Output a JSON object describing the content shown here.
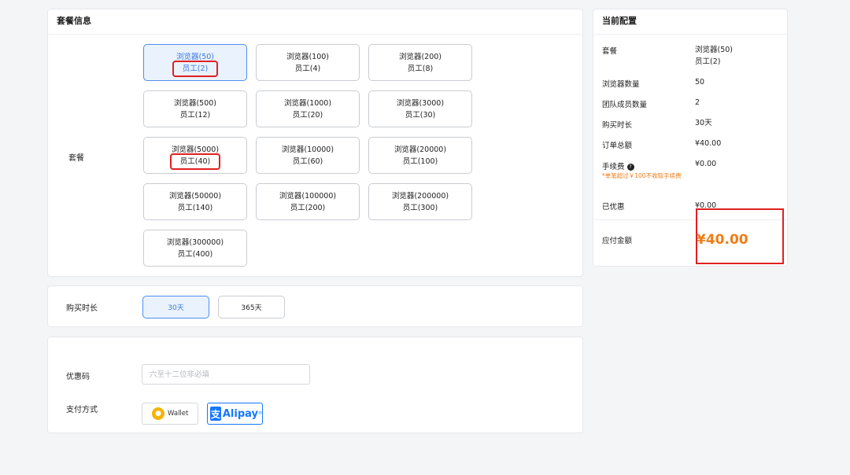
{
  "plan_card": {
    "title": "套餐信息",
    "label": "套餐",
    "plans": [
      {
        "line1": "浏览器(50)",
        "line2": "员工(2)"
      },
      {
        "line1": "浏览器(100)",
        "line2": "员工(4)"
      },
      {
        "line1": "浏览器(200)",
        "line2": "员工(8)"
      },
      {
        "line1": "浏览器(500)",
        "line2": "员工(12)"
      },
      {
        "line1": "浏览器(1000)",
        "line2": "员工(20)"
      },
      {
        "line1": "浏览器(3000)",
        "line2": "员工(30)"
      },
      {
        "line1": "浏览器(5000)",
        "line2": "员工(40)"
      },
      {
        "line1": "浏览器(10000)",
        "line2": "员工(60)"
      },
      {
        "line1": "浏览器(20000)",
        "line2": "员工(100)"
      },
      {
        "line1": "浏览器(50000)",
        "line2": "员工(140)"
      },
      {
        "line1": "浏览器(100000)",
        "line2": "员工(200)"
      },
      {
        "line1": "浏览器(200000)",
        "line2": "员工(300)"
      },
      {
        "line1": "浏览器(300000)",
        "line2": "员工(400)"
      }
    ]
  },
  "duration": {
    "label": "购买时长",
    "options": [
      "30天",
      "365天"
    ]
  },
  "payment": {
    "coupon_label": "优惠码",
    "coupon_placeholder": "六至十二位非必填",
    "method_label": "支付方式",
    "wallet_label": "Wallet",
    "alipay_label": "Alipay",
    "alipay_glyph": "支"
  },
  "config": {
    "title": "当前配置",
    "plan_label": "套餐",
    "plan_value_1": "浏览器(50)",
    "plan_value_2": "员工(2)",
    "browsers_label": "浏览器数量",
    "browsers_value": "50",
    "members_label": "团队成员数量",
    "members_value": "2",
    "duration_label": "购买时长",
    "duration_value": "30天",
    "order_total_label": "订单总额",
    "order_total_value": "¥40.00",
    "fee_label": "手续费",
    "fee_value": "¥0.00",
    "fee_note": "*单笔超过￥100不收取手续费",
    "discount_label": "已优惠",
    "discount_value": "¥0.00",
    "payable_label": "应付金额",
    "payable_value": "¥40.00"
  },
  "colors": {
    "accent": "#3a78e0",
    "price": "#f07d17",
    "highlight": "#e02020",
    "alipay": "#1677ff"
  }
}
